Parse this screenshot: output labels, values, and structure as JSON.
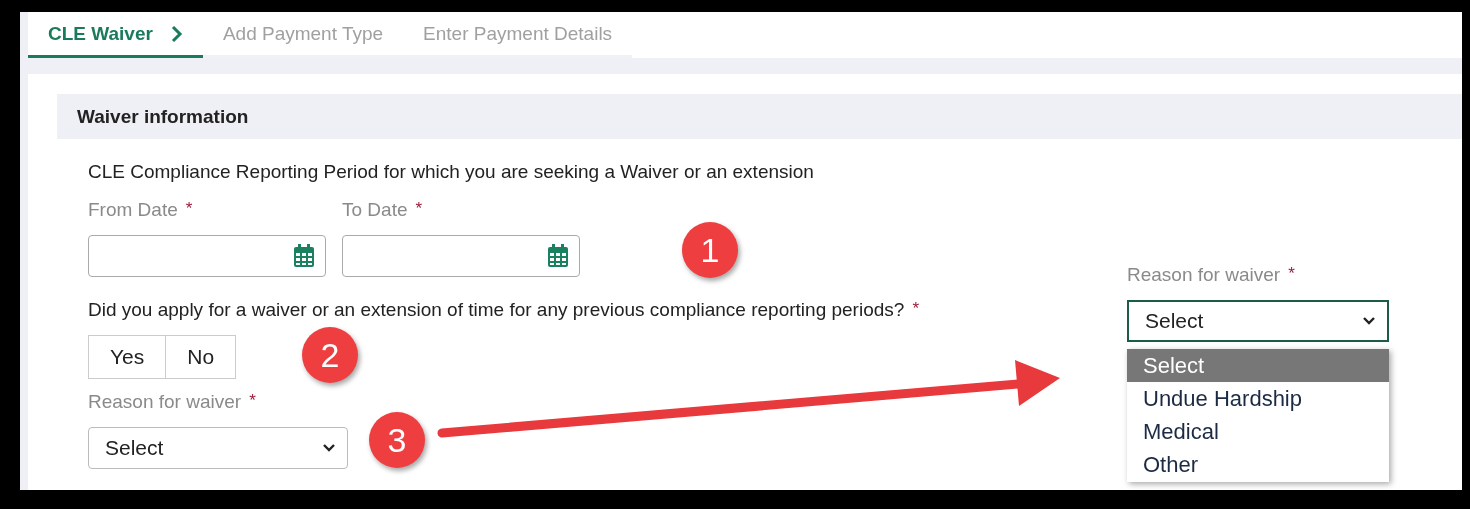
{
  "tabs": [
    {
      "label": "CLE Waiver",
      "selected": true
    },
    {
      "label": "Add Payment Type",
      "selected": false
    },
    {
      "label": "Enter Payment Details",
      "selected": false
    }
  ],
  "section": {
    "title": "Waiver information"
  },
  "period_label": "CLE Compliance Reporting Period for which you are seeking a Waiver or an extension",
  "date_fields": [
    {
      "label": "From Date",
      "required_mark": "*"
    },
    {
      "label": "To Date",
      "required_mark": "*"
    }
  ],
  "question": {
    "text": "Did you apply for a waiver or an extension of time for any previous compliance reporting periods?",
    "required_mark": "*"
  },
  "answers": [
    {
      "label": "Yes"
    },
    {
      "label": "No"
    }
  ],
  "reason_field": {
    "label": "Reason for waiver",
    "required_mark": "*",
    "value": "Select"
  },
  "callout": {
    "label": "Reason for waiver",
    "required_mark": "*",
    "value": "Select",
    "options": [
      {
        "label": "Select",
        "selected": true
      },
      {
        "label": "Undue Hardship",
        "selected": false
      },
      {
        "label": "Medical",
        "selected": false
      },
      {
        "label": "Other",
        "selected": false
      }
    ]
  },
  "annotations": [
    {
      "label": "1"
    },
    {
      "label": "2"
    },
    {
      "label": "3"
    }
  ]
}
